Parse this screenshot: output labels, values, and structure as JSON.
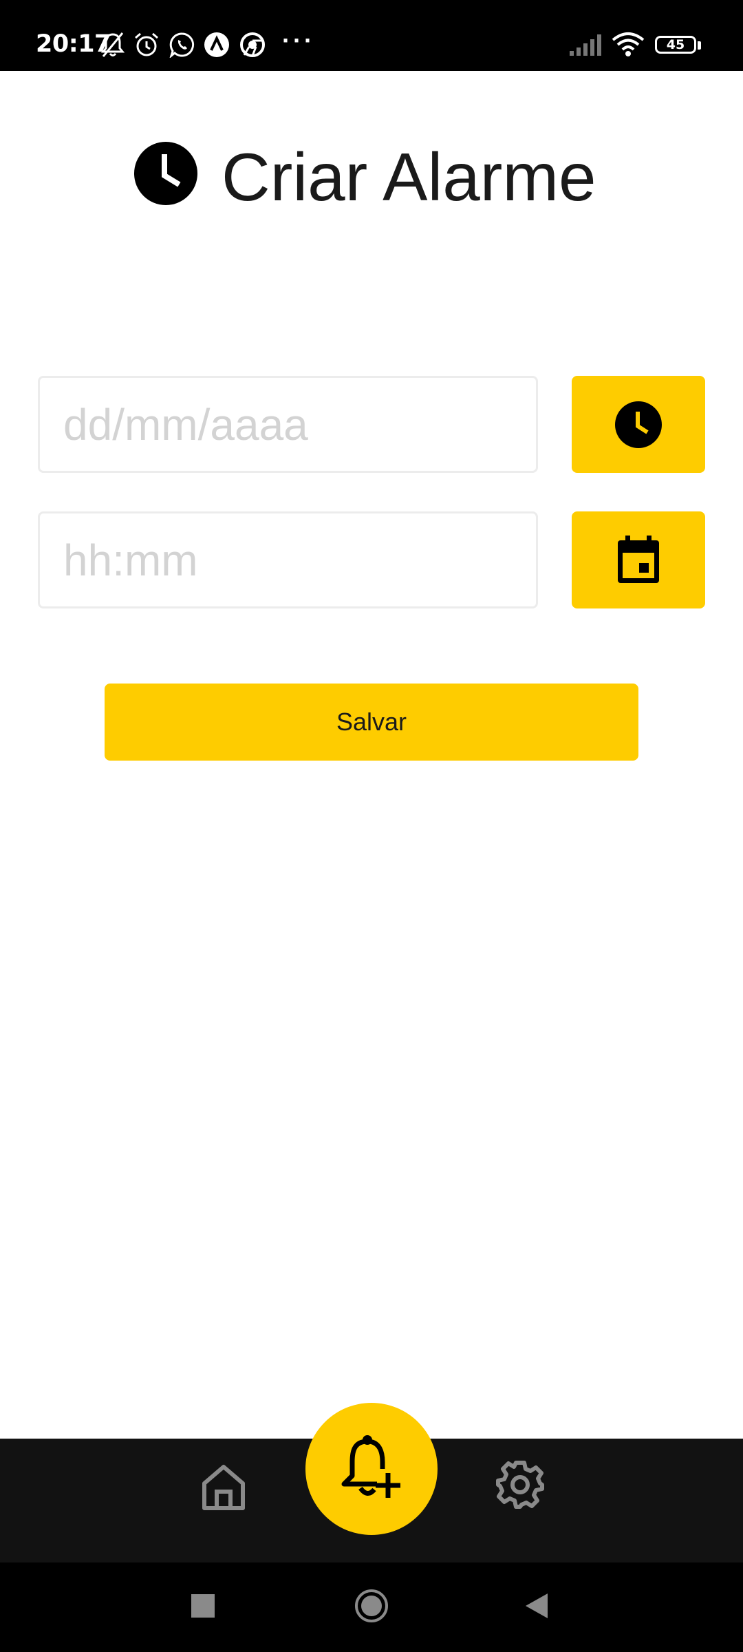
{
  "status_bar": {
    "time": "20:17",
    "battery_level": "45",
    "icons": [
      "bell-off-icon",
      "alarm-icon",
      "whatsapp-icon",
      "app-a-icon",
      "chrome-icon",
      "more-dots-icon",
      "signal-icon",
      "wifi-icon",
      "battery-icon"
    ]
  },
  "header": {
    "title": "Criar Alarme",
    "icon": "clock-icon"
  },
  "form": {
    "date_placeholder": "dd/mm/aaaa",
    "time_placeholder": "hh:mm",
    "date_button_icon": "clock-icon",
    "time_button_icon": "calendar-icon",
    "save_label": "Salvar"
  },
  "bottom_nav": {
    "items": [
      {
        "icon": "home-icon"
      },
      {
        "icon": "add-alarm-icon",
        "active": true
      },
      {
        "icon": "gear-icon"
      }
    ]
  },
  "system_nav": {
    "items": [
      {
        "icon": "recents-square-icon"
      },
      {
        "icon": "home-circle-icon"
      },
      {
        "icon": "back-triangle-icon"
      }
    ]
  },
  "colors": {
    "accent": "#fecc00",
    "status_bar_bg": "#000000",
    "bottom_nav_bg": "#121212",
    "text": "#1a1a1a",
    "placeholder": "#d3d3d3"
  }
}
